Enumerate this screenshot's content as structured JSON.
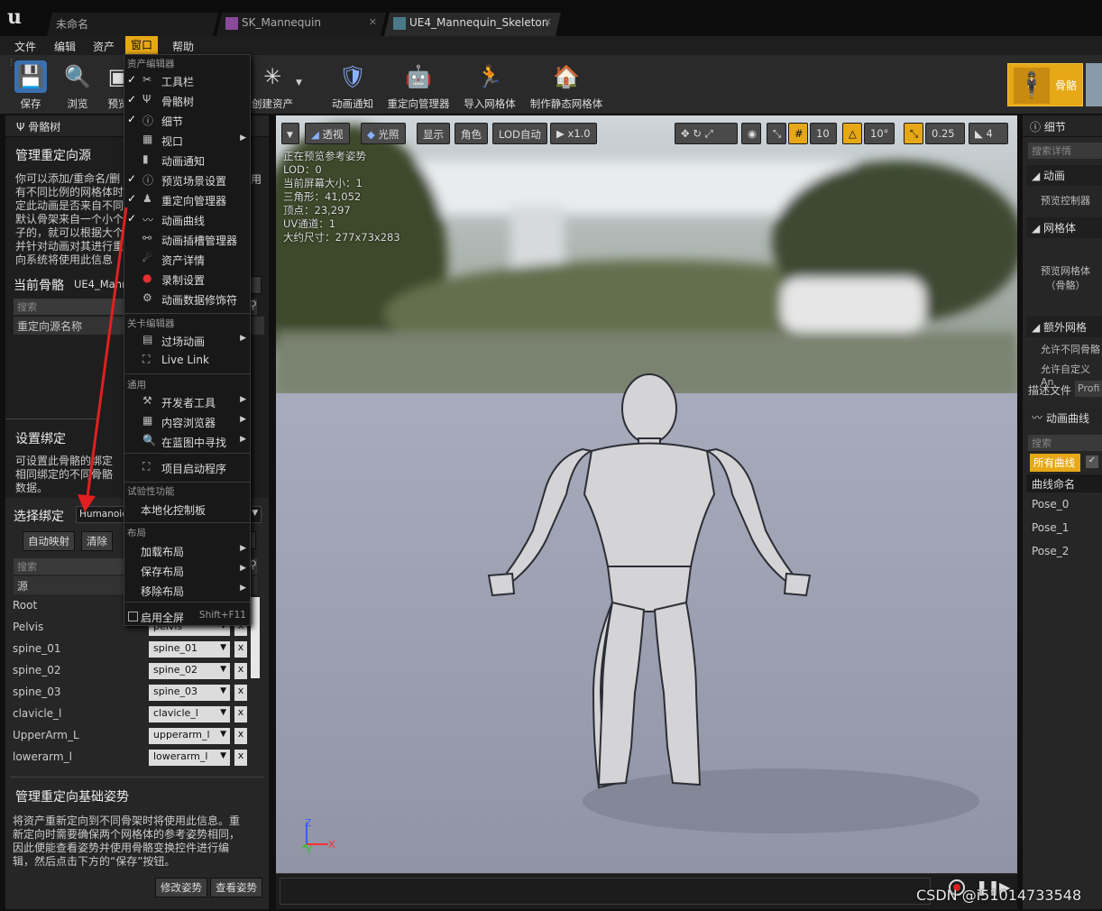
{
  "tabs": [
    {
      "label": "未命名"
    },
    {
      "label": "SK_Mannequin"
    },
    {
      "label": "UE4_Mannequin_Skeleton"
    }
  ],
  "menubar": [
    "文件",
    "编辑",
    "资产",
    "窗口",
    "帮助"
  ],
  "toolbar": {
    "save": "保存",
    "browse": "浏览",
    "preview": "预览",
    "create_asset": "创建资产",
    "anim_notify": "动画通知",
    "retarget_manager": "重定向管理器",
    "import_mesh": "导入网格体",
    "make_static_mesh": "制作静态网格体",
    "skeleton": "骨骼"
  },
  "left": {
    "tree_tab": "骨骼树",
    "manage_title": "管理重定向源",
    "manage_desc": [
      "你可以添加/重命名/删",
      "有不同比例的网格体时",
      "定此动画是否来自不同",
      "默认骨架来自一个小个",
      "子的，就可以根据大个",
      "并针对动画对其进行重",
      "向系统将使用此信息"
    ],
    "manage_desc_tail": "用",
    "current_skel_label": "当前骨骼",
    "current_skel_value": "UE4_Mann",
    "search_placeholder": "搜索",
    "col_source_name": "重定向源名称",
    "binding_title": "设置绑定",
    "binding_desc": [
      "可设置此骨骼的绑定",
      "相同绑定的不同骨骼",
      "数据。"
    ],
    "select_binding_label": "选择绑定",
    "select_binding_value": "Humanoid",
    "auto_map": "自动映射",
    "clear": "清除",
    "col_source": "源",
    "bones": [
      {
        "name": "Root",
        "target": ""
      },
      {
        "name": "Pelvis",
        "target": "pelvis"
      },
      {
        "name": "spine_01",
        "target": "spine_01"
      },
      {
        "name": "spine_02",
        "target": "spine_02"
      },
      {
        "name": "spine_03",
        "target": "spine_03"
      },
      {
        "name": "clavicle_l",
        "target": "clavicle_l"
      },
      {
        "name": "UpperArm_L",
        "target": "upperarm_l"
      },
      {
        "name": "lowerarm_l",
        "target": "lowerarm_l"
      }
    ],
    "x_label": "x",
    "base_pose_title": "管理重定向基础姿势",
    "base_pose_desc": [
      "将资产重新定向到不同骨架时将使用此信息。重",
      "新定向时需要确保两个网格体的参考姿势相同，",
      "因此便能查看姿势并使用骨骼变换控件进行编",
      "辑，然后点击下方的“保存”按钮。"
    ],
    "modify_pose": "修改姿势",
    "view_pose": "查看姿势"
  },
  "viewport": {
    "perspective": "透视",
    "lit": "光照",
    "show": "显示",
    "character": "角色",
    "lod": "LOD自动",
    "speed": "x1.0",
    "grid_snap": "10",
    "angle_snap": "10°",
    "scale_snap": "0.25",
    "cam_speed": "4",
    "stats": [
      "正在预览参考姿势",
      "LOD：0",
      "当前屏幕大小：1",
      "三角形：41,052",
      "顶点：23,297",
      "UV通道：1",
      "大约尺寸：277x73x283"
    ],
    "axis_z": "Z",
    "axis_x": "X",
    "axis_y": "Y"
  },
  "right": {
    "details_tab": "细节",
    "search_details": "搜索详情",
    "anim_section": "动画",
    "preview_controller": "预览控制器",
    "mesh_section": "网格体",
    "preview_mesh": [
      "预览网格体",
      "（骨骼）"
    ],
    "extra_mesh": "额外网格",
    "allow_diff_bones": "允许不同骨骼",
    "allow_custom": "允许自定义An",
    "profile_label": "描述文件",
    "profile_value": "Profi",
    "anim_curve_tab": "动画曲线",
    "search": "搜索",
    "all_curves": "所有曲线",
    "curve_name": "曲线命名",
    "curves": [
      "Pose_0",
      "Pose_1",
      "Pose_2"
    ]
  },
  "window_menu": {
    "sec_asset_editor": "资产编辑器",
    "items1": [
      "工具栏",
      "骨骼树",
      "细节",
      "视口",
      "动画通知",
      "预览场景设置",
      "重定向管理器",
      "动画曲线",
      "动画插槽管理器",
      "资产详情",
      "录制设置",
      "动画数据修饰符"
    ],
    "sec_level_editor": "关卡编辑器",
    "items2": [
      "过场动画",
      "Live Link"
    ],
    "sec_general": "通用",
    "items3": [
      "开发者工具",
      "内容浏览器",
      "在蓝图中寻找"
    ],
    "project_launcher": "项目启动程序",
    "sec_experimental": "试验性功能",
    "localization": "本地化控制板",
    "sec_layout": "布局",
    "items4": [
      "加载布局",
      "保存布局",
      "移除布局"
    ],
    "fullscreen": "启用全屏",
    "fullscreen_key": "Shift+F11"
  },
  "watermark": "CSDN @i51014733548",
  "colors": {
    "accent": "#e6a817",
    "arrow": "#e02020"
  }
}
